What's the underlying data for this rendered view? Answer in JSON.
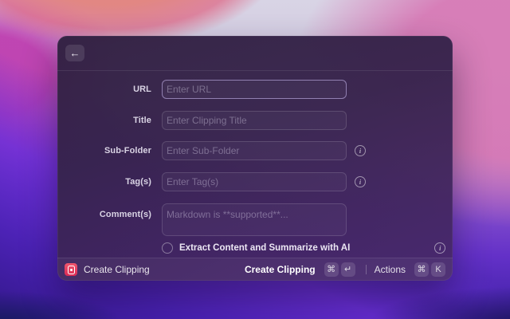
{
  "header": {
    "back_icon": "←"
  },
  "form": {
    "fields": [
      {
        "label": "URL",
        "placeholder": "Enter URL",
        "focused": true,
        "has_info": false
      },
      {
        "label": "Title",
        "placeholder": "Enter Clipping Title",
        "focused": false,
        "has_info": false
      },
      {
        "label": "Sub-Folder",
        "placeholder": "Enter Sub-Folder",
        "focused": false,
        "has_info": true
      },
      {
        "label": "Tag(s)",
        "placeholder": "Enter Tag(s)",
        "focused": false,
        "has_info": true
      },
      {
        "label": "Comment(s)",
        "placeholder": "Markdown is **supported**...",
        "focused": false,
        "has_info": false,
        "multiline": true
      }
    ],
    "checkbox": {
      "label": "Extract Content and Summarize with AI",
      "checked": false,
      "has_info": true
    }
  },
  "icons": {
    "info_glyph": "i"
  },
  "footer": {
    "app_label": "Create Clipping",
    "primary": {
      "label": "Create Clipping",
      "keys": [
        "⌘",
        "↵"
      ]
    },
    "secondary": {
      "label": "Actions",
      "keys": [
        "⌘",
        "K"
      ]
    }
  },
  "colors": {
    "window_tint": "#362350",
    "focus_border": "#c7b6ee",
    "app_icon_red": "#e03a5c",
    "wallpaper_magenta": "#be3eb0",
    "wallpaper_coral": "#e2837e",
    "wallpaper_violet": "#6c2fd8"
  }
}
